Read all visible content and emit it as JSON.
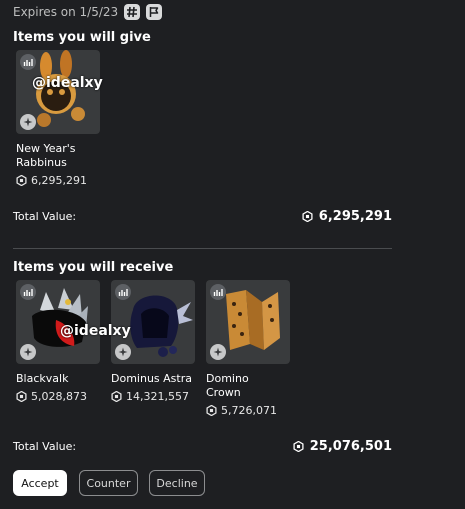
{
  "header": {
    "expires": "Expires on 1/5/23",
    "icons": [
      "hash-icon",
      "flag-icon"
    ]
  },
  "give": {
    "title": "Items you will give",
    "items": [
      {
        "name": "New Year's Rabbinus",
        "value": "6,295,291"
      }
    ],
    "total_label": "Total Value:",
    "total_value": "6,295,291"
  },
  "receive": {
    "title": "Items you will receive",
    "items": [
      {
        "name": "Blackvalk",
        "value": "5,028,873"
      },
      {
        "name": "Dominus Astra",
        "value": "14,321,557"
      },
      {
        "name": "Domino Crown",
        "value": "5,726,071"
      }
    ],
    "total_label": "Total Value:",
    "total_value": "25,076,501"
  },
  "watermarks": [
    "@idealxy",
    "@idealxy"
  ],
  "actions": {
    "accept": "Accept",
    "counter": "Counter",
    "decline": "Decline"
  },
  "colors": {
    "background": "#1e1f22",
    "card": "#393b3d",
    "accept_bg": "#ffffff"
  }
}
